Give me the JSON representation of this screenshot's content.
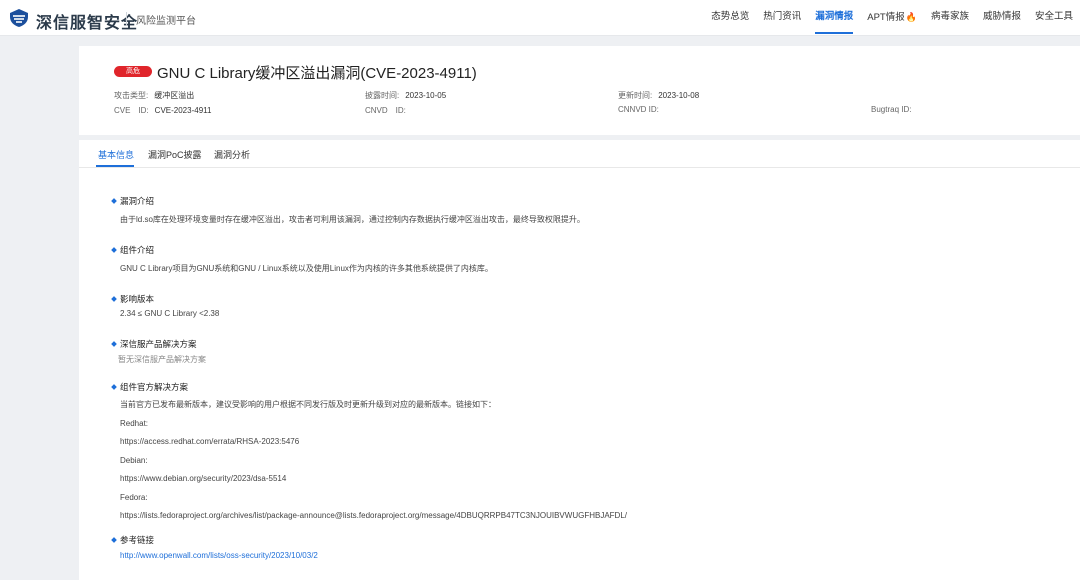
{
  "brand": {
    "name": "深信服智安全",
    "platform": "风险监测平台"
  },
  "nav": [
    {
      "label": "态势总览",
      "active": false
    },
    {
      "label": "热门资讯",
      "active": false
    },
    {
      "label": "漏洞情报",
      "active": true
    },
    {
      "label": "APT情报",
      "active": false,
      "hot": true
    },
    {
      "label": "病毒家族",
      "active": false
    },
    {
      "label": "威胁情报",
      "active": false
    },
    {
      "label": "安全工具",
      "active": false
    }
  ],
  "vuln": {
    "severity": "高危",
    "title": "GNU C Library缓冲区溢出漏洞(CVE-2023-4911)",
    "attack_type_label": "攻击类型:",
    "attack_type": "缓冲区溢出",
    "disclosed_label": "披露时间:",
    "disclosed": "2023-10-05",
    "updated_label": "更新时间:",
    "updated": "2023-10-08",
    "cve_label": "CVE　ID:",
    "cve": "CVE-2023-4911",
    "cnvd_label": "CNVD　ID:",
    "cnvd": "",
    "cnnvd_label": "CNNVD ID:",
    "cnnvd": "",
    "bugtraq_label": "Bugtraq ID:",
    "bugtraq": ""
  },
  "tabs": [
    {
      "label": "基本信息"
    },
    {
      "label": "漏洞PoC披露"
    },
    {
      "label": "漏洞分析"
    }
  ],
  "sections": {
    "intro": {
      "title": "漏洞介绍",
      "body": "由于ld.so库在处理环境变量时存在缓冲区溢出，攻击者可利用该漏洞，通过控制内存数据执行缓冲区溢出攻击，最终导致权限提升。"
    },
    "component": {
      "title": "组件介绍",
      "body": "GNU C Library项目为GNU系统和GNU / Linux系统以及使用Linux作为内核的许多其他系统提供了内核库。"
    },
    "versions": {
      "title": "影响版本",
      "body": "2.34 ≤ GNU C Library <2.38"
    },
    "sangfor": {
      "title": "深信服产品解决方案",
      "body": "暂无深信服产品解决方案"
    },
    "official": {
      "title": "组件官方解决方案",
      "lines": [
        "当前官方已发布最新版本，建议受影响的用户根据不同发行版及时更新升级到对应的最新版本。链接如下：",
        "Redhat:",
        "https://access.redhat.com/errata/RHSA-2023:5476",
        "Debian:",
        "https://www.debian.org/security/2023/dsa-5514",
        "Fedora:",
        "https://lists.fedoraproject.org/archives/list/package-announce@lists.fedoraproject.org/message/4DBUQRRPB47TC3NJOUIBVWUGFHBJAFDL/"
      ]
    },
    "refs": {
      "title": "参考链接",
      "link": "http://www.openwall.com/lists/oss-security/2023/10/03/2"
    }
  },
  "colors": {
    "accent": "#1e6fd9",
    "severity_high": "#e0252b",
    "hot": "#e8521e"
  }
}
